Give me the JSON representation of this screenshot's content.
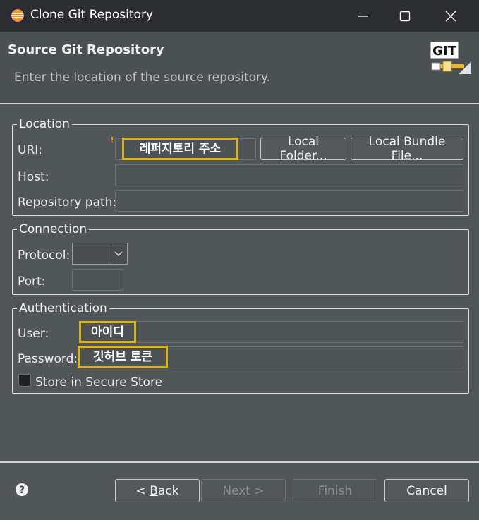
{
  "window": {
    "title": "Clone Git Repository"
  },
  "header": {
    "title": "Source Git Repository",
    "description": "Enter the location of the source repository.",
    "logo_text": "GIT"
  },
  "location": {
    "legend": "Location",
    "uri_label": "URI:",
    "uri_value": "레퍼지토리 주소",
    "local_folder_button": "Local Folder...",
    "local_bundle_button": "Local Bundle File...",
    "host_label": "Host:",
    "repo_path_label": "Repository path:"
  },
  "connection": {
    "legend": "Connection",
    "protocol_label": "Protocol:",
    "port_label": "Port:"
  },
  "authentication": {
    "legend": "Authentication",
    "user_label": "User:",
    "user_value": "아이디",
    "password_label": "Password:",
    "password_value": "깃허브 토큰",
    "store_label_first": "S",
    "store_label_rest": "tore in Secure Store"
  },
  "footer": {
    "back_prefix": "< ",
    "back_mnemonic": "B",
    "back_rest": "ack",
    "next_button": "Next >",
    "finish_button": "Finish",
    "cancel_button": "Cancel"
  },
  "colors": {
    "highlight_border": "#d6b51a",
    "background": "#515658",
    "titlebar": "#2b2d30"
  },
  "icons": [
    "eclipse-icon",
    "minimize-icon",
    "maximize-icon",
    "close-icon",
    "git-logo-icon",
    "required-marker-icon",
    "chevron-down-icon",
    "help-icon"
  ]
}
